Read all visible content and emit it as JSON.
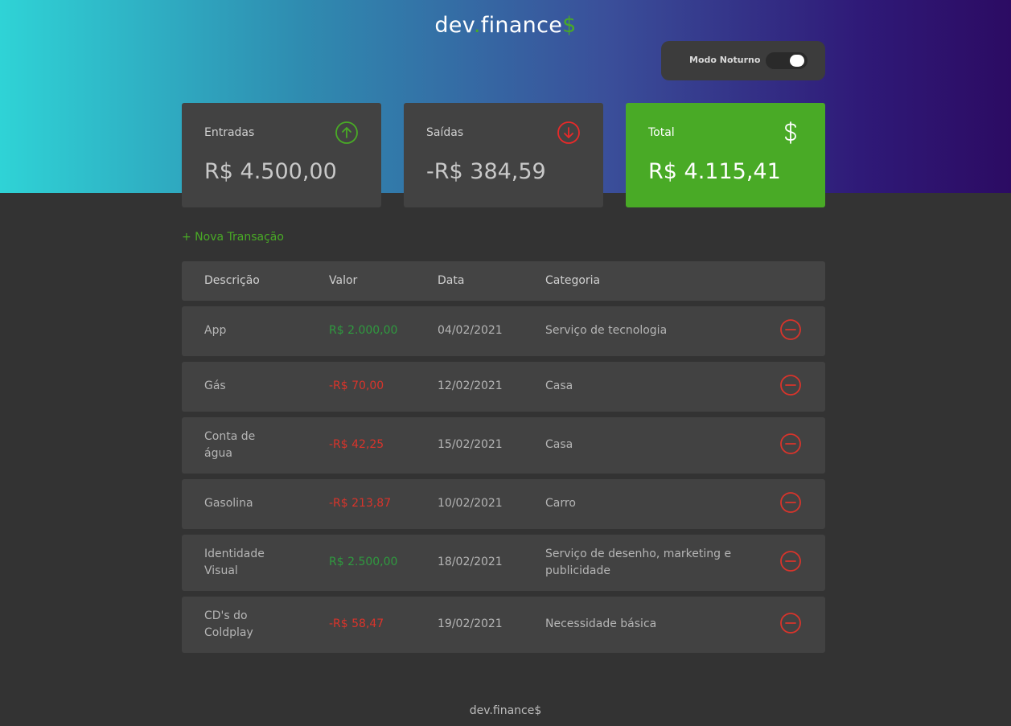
{
  "header": {
    "logo_main": "dev",
    "logo_dot": ".",
    "logo_rest": "finance",
    "logo_dollar": "$",
    "night_mode_label": "Modo Noturno",
    "night_mode_on": true
  },
  "cards": {
    "income": {
      "label": "Entradas",
      "value": "R$ 4.500,00",
      "icon": "arrow-up-circle-icon",
      "icon_color": "#49aa26"
    },
    "expense": {
      "label": "Saídas",
      "value": "-R$ 384,59",
      "icon": "arrow-down-circle-icon",
      "icon_color": "#e92929"
    },
    "total": {
      "label": "Total",
      "value": "R$ 4.115,41",
      "icon": "dollar-icon",
      "bg_color": "#49aa26"
    }
  },
  "new_transaction_label": "+ Nova Transação",
  "table": {
    "headers": {
      "description": "Descrição",
      "value": "Valor",
      "date": "Data",
      "category": "Categoria"
    },
    "rows": [
      {
        "description": "App",
        "value": "R$ 2.000,00",
        "type": "income",
        "date": "04/02/2021",
        "category": "Serviço de tecnologia"
      },
      {
        "description": "Gás",
        "value": "-R$ 70,00",
        "type": "expense",
        "date": "12/02/2021",
        "category": "Casa"
      },
      {
        "description": "Conta de água",
        "value": "-R$ 42,25",
        "type": "expense",
        "date": "15/02/2021",
        "category": "Casa"
      },
      {
        "description": "Gasolina",
        "value": "-R$ 213,87",
        "type": "expense",
        "date": "10/02/2021",
        "category": "Carro"
      },
      {
        "description": "Identidade Visual",
        "value": "R$ 2.500,00",
        "type": "income",
        "date": "18/02/2021",
        "category": "Serviço de desenho, marketing e publicidade"
      },
      {
        "description": "CD's do Coldplay",
        "value": "-R$ 58,47",
        "type": "expense",
        "date": "19/02/2021",
        "category": "Necessidade básica"
      }
    ]
  },
  "footer": {
    "text": "dev.finance$"
  },
  "colors": {
    "income": "#2f9a3f",
    "expense": "#d9342b",
    "remove_icon": "#d9342b",
    "accent": "#49aa26"
  }
}
